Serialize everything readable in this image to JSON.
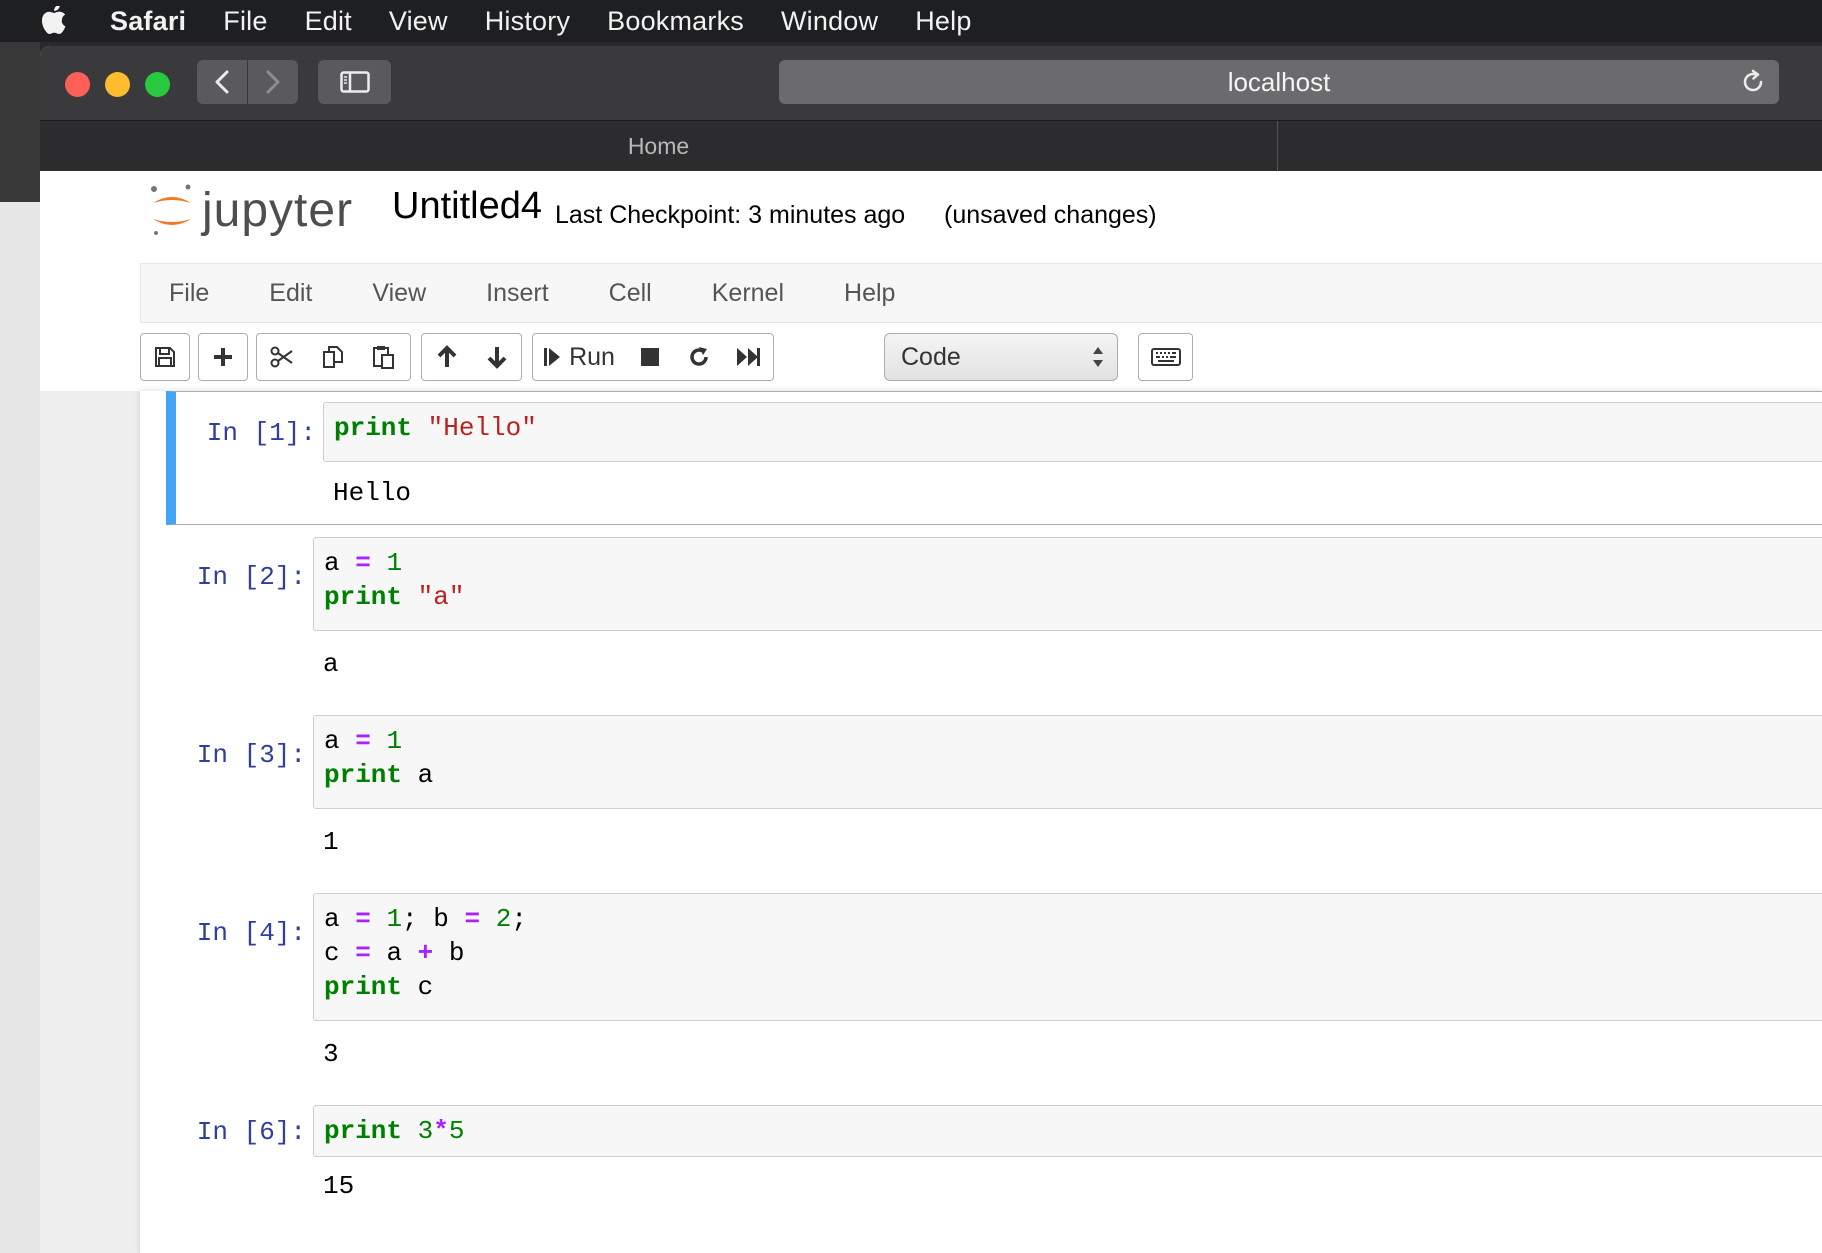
{
  "mac_menubar": {
    "items": [
      "Safari",
      "File",
      "Edit",
      "View",
      "History",
      "Bookmarks",
      "Window",
      "Help"
    ]
  },
  "browser": {
    "url": "localhost",
    "tab_title": "Home"
  },
  "jupyter": {
    "logo_text": "jupyter",
    "notebook_name": "Untitled4",
    "checkpoint": "Last Checkpoint: 3 minutes ago",
    "status": "(unsaved changes)",
    "menu": [
      "File",
      "Edit",
      "View",
      "Insert",
      "Cell",
      "Kernel",
      "Help"
    ],
    "toolbar": {
      "run_label": "Run",
      "cell_type": "Code",
      "icons": [
        "save-icon",
        "plus-icon",
        "scissors-icon",
        "copy-icon",
        "paste-icon",
        "arrow-up-icon",
        "arrow-down-icon",
        "step-forward-icon",
        "stop-icon",
        "restart-icon",
        "fast-forward-icon",
        "keyboard-icon"
      ]
    },
    "cells": [
      {
        "prompt": "In [1]:",
        "output": "Hello"
      },
      {
        "prompt": "In [2]:",
        "output": "a"
      },
      {
        "prompt": "In [3]:",
        "output": "1"
      },
      {
        "prompt": "In [4]:",
        "output": "3"
      },
      {
        "prompt": "In [6]:",
        "output": "15"
      }
    ],
    "code": {
      "c1": {
        "kw": "print",
        "str": "\"Hello\""
      },
      "c2": {
        "var_a": "a",
        "eq": "=",
        "one": "1",
        "kw": "print",
        "str": "\"a\""
      },
      "c3": {
        "var_a": "a",
        "eq": "=",
        "one": "1",
        "kw": "print",
        "arg": "a"
      },
      "c4": {
        "a": "a",
        "eq1": "=",
        "n1": "1",
        "semi1": ";",
        "b": "b",
        "eq2": "=",
        "n2": "2",
        "semi2": ";",
        "c": "c",
        "eq3": "=",
        "a2": "a",
        "plus": "+",
        "b2": "b",
        "kw": "print",
        "arg": "c"
      },
      "c6": {
        "kw": "print",
        "n3": "3",
        "times": "*",
        "n5": "5"
      }
    }
  },
  "colors": {
    "keyword": "#008000",
    "string": "#ba2121",
    "operator": "#aa22ff",
    "prompt": "#303f9f",
    "selected_border": "#42a5f5"
  }
}
